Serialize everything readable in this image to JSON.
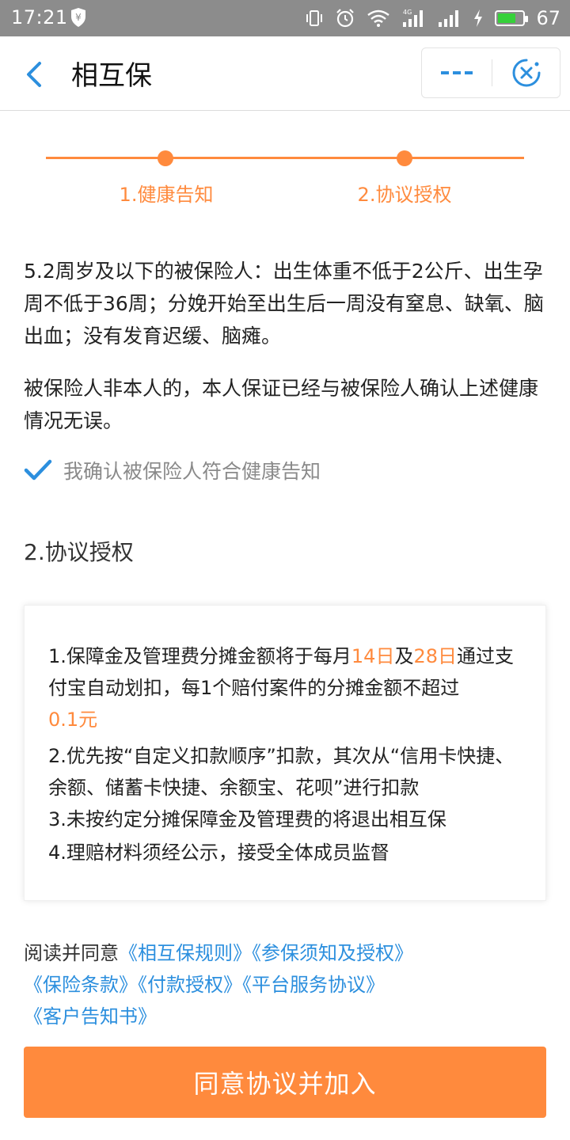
{
  "status_bar": {
    "time": "17:21",
    "battery_level": "67"
  },
  "nav": {
    "title": "相互保"
  },
  "steps": {
    "items": [
      "1.健康告知",
      "2.协议授权"
    ]
  },
  "health_notice": {
    "paragraph1": "5.2周岁及以下的被保险人：出生体重不低于2公斤、出生孕周不低于36周；分娩开始至出生后一周没有窒息、缺氧、脑出血；没有发育迟缓、脑瘫。",
    "paragraph2": "被保险人非本人的，本人保证已经与被保险人确认上述健康情况无误。",
    "confirm_label": "我确认被保险人符合健康告知"
  },
  "authorization": {
    "section_title": "2.协议授权",
    "item1": {
      "part_a": "1.保障金及管理费分摊金额将于每月",
      "date1": "14日",
      "part_b": "及",
      "date2": "28日",
      "part_c": "通过支付宝自动划扣，每1个赔付案件的分摊金额不超过",
      "amount": "0.1元"
    },
    "item2": "2.优先按“自定义扣款顺序”扣款，其次从“信用卡快捷、余额、储蓄卡快捷、余额宝、花呗”进行扣款",
    "item3": "3.未按约定分摊保障金及管理费的将退出相互保",
    "item4": "4.理赔材料须经公示，接受全体成员监督"
  },
  "agreement": {
    "prefix": "阅读并同意",
    "links": [
      "《相互保规则》",
      "《参保须知及授权》",
      "《保险条款》",
      "《付款授权》",
      "《平台服务协议》",
      "《客户告知书》"
    ]
  },
  "join_button": "同意协议并加入",
  "colors": {
    "accent": "#ff8a3d",
    "link": "#2c8fde",
    "check": "#2c8fde"
  }
}
